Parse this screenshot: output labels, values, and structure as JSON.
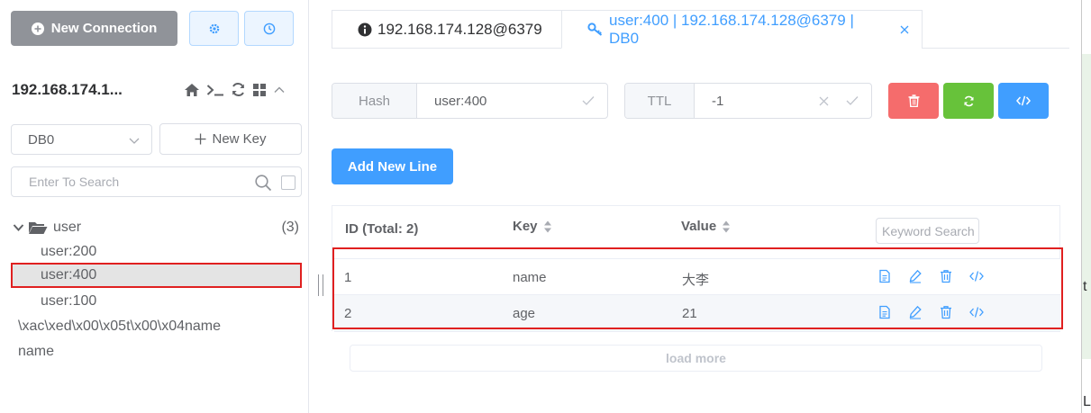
{
  "colors": {
    "primary": "#409eff",
    "danger": "#f56c6c",
    "success": "#67c23a",
    "gray_button": "#909399",
    "highlight_border": "#e02020"
  },
  "sidebar": {
    "new_connection_label": "New Connection",
    "connection_name": "192.168.174.1...",
    "db_select_value": "DB0",
    "new_key_label": "New Key",
    "search_placeholder": "Enter To Search",
    "tree": {
      "folder_name": "user",
      "folder_count": "(3)",
      "children": [
        "user:200",
        "user:400",
        "user:100"
      ],
      "selected": "user:400",
      "others": [
        "\\xac\\xed\\x00\\x05t\\x00\\x04name",
        "name"
      ]
    }
  },
  "tabs": [
    {
      "label": "192.168.174.128@6379",
      "icon": "info-circle-icon",
      "active": false
    },
    {
      "label": "user:400 | 192.168.174.128@6379 | DB0",
      "icon": "key-icon",
      "active": true
    }
  ],
  "key_header": {
    "type_label": "Hash",
    "key_name": "user:400",
    "ttl_label": "TTL",
    "ttl_value": "-1"
  },
  "add_new_line_label": "Add New Line",
  "table": {
    "headers": {
      "id": "ID (Total: 2)",
      "key": "Key",
      "value": "Value"
    },
    "keyword_placeholder": "Keyword Search",
    "rows": [
      {
        "id": "1",
        "key": "name",
        "value": "大李"
      },
      {
        "id": "2",
        "key": "age",
        "value": "21"
      }
    ],
    "load_more_label": "load more"
  },
  "edge_fragment": {
    "chars": [
      "t",
      "L"
    ]
  }
}
